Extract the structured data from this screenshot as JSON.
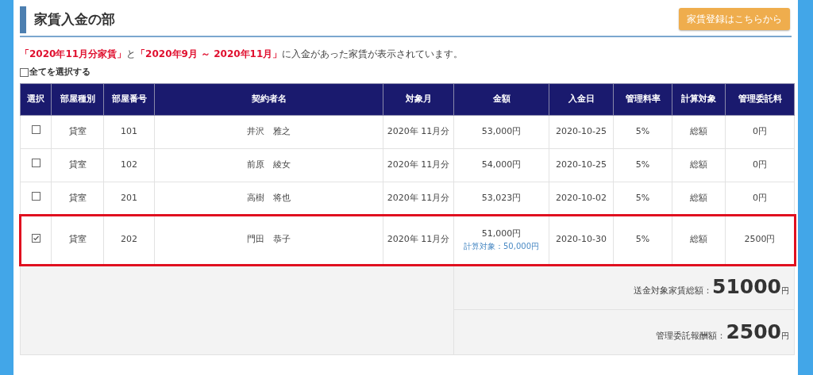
{
  "header": {
    "title": "家賃入金の部",
    "button": "家賃登録はこちらから"
  },
  "description": "**「2020年11月分家賃」**と**「2020年9月 ～ 2020年11月」**に入金があった家賃が表示されています。",
  "select_all": {
    "label": "全てを選択する",
    "checked": false
  },
  "table": {
    "columns": [
      "選択",
      "部屋種別",
      "部屋番号",
      "契約者名",
      "対象月",
      "金額",
      "入金日",
      "管理料率",
      "計算対象",
      "管理委託料"
    ],
    "rows": [
      {
        "checked": false,
        "highlighted": false,
        "type": "貸室",
        "room": "101",
        "name": "井沢　雅之",
        "month": "2020年 11月分",
        "amount": "53,000円",
        "date": "2020-10-25",
        "rate": "5%",
        "basis": "総額",
        "fee": "0円"
      },
      {
        "checked": false,
        "highlighted": false,
        "type": "貸室",
        "room": "102",
        "name": "前原　綾女",
        "month": "2020年 11月分",
        "amount": "54,000円",
        "date": "2020-10-25",
        "rate": "5%",
        "basis": "総額",
        "fee": "0円"
      },
      {
        "checked": false,
        "highlighted": false,
        "type": "貸室",
        "room": "201",
        "name": "高樹　将也",
        "month": "2020年 11月分",
        "amount": "53,023円",
        "date": "2020-10-02",
        "rate": "5%",
        "basis": "総額",
        "fee": "0円"
      },
      {
        "checked": true,
        "highlighted": true,
        "type": "貸室",
        "room": "202",
        "name": "門田　恭子",
        "month": "2020年 11月分",
        "amount": "51,000円",
        "amount_note": "計算対象：50,000円",
        "date": "2020-10-30",
        "rate": "5%",
        "basis": "総額",
        "fee": "2500円"
      }
    ],
    "totals": [
      {
        "label": "送金対象家賃総額：",
        "value": "51000",
        "unit": "円"
      },
      {
        "label": "管理委託報酬額：",
        "value": "2500",
        "unit": "円"
      }
    ]
  }
}
